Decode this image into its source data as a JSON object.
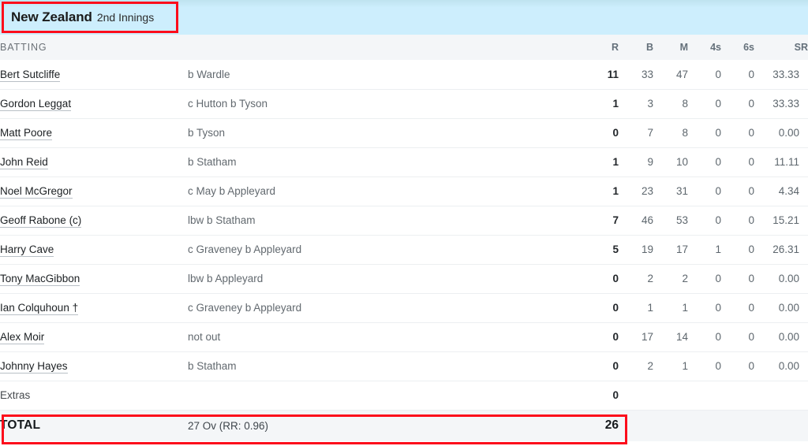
{
  "innings": {
    "team": "New Zealand",
    "label": "2nd Innings"
  },
  "table": {
    "headers": {
      "batting": "BATTING",
      "r": "R",
      "b": "B",
      "m": "M",
      "fours": "4s",
      "sixes": "6s",
      "sr": "SR"
    },
    "rows": [
      {
        "player": "Bert Sutcliffe",
        "dismissal": "b Wardle",
        "r": "11",
        "b": "33",
        "m": "47",
        "fours": "0",
        "sixes": "0",
        "sr": "33.33"
      },
      {
        "player": "Gordon Leggat",
        "dismissal": "c Hutton b Tyson",
        "r": "1",
        "b": "3",
        "m": "8",
        "fours": "0",
        "sixes": "0",
        "sr": "33.33"
      },
      {
        "player": "Matt Poore",
        "dismissal": "b Tyson",
        "r": "0",
        "b": "7",
        "m": "8",
        "fours": "0",
        "sixes": "0",
        "sr": "0.00"
      },
      {
        "player": "John Reid",
        "dismissal": "b Statham",
        "r": "1",
        "b": "9",
        "m": "10",
        "fours": "0",
        "sixes": "0",
        "sr": "11.11"
      },
      {
        "player": "Noel McGregor",
        "dismissal": "c May b Appleyard",
        "r": "1",
        "b": "23",
        "m": "31",
        "fours": "0",
        "sixes": "0",
        "sr": "4.34"
      },
      {
        "player": "Geoff Rabone (c)",
        "dismissal": "lbw b Statham",
        "r": "7",
        "b": "46",
        "m": "53",
        "fours": "0",
        "sixes": "0",
        "sr": "15.21"
      },
      {
        "player": "Harry Cave",
        "dismissal": "c Graveney b Appleyard",
        "r": "5",
        "b": "19",
        "m": "17",
        "fours": "1",
        "sixes": "0",
        "sr": "26.31"
      },
      {
        "player": "Tony MacGibbon",
        "dismissal": "lbw b Appleyard",
        "r": "0",
        "b": "2",
        "m": "2",
        "fours": "0",
        "sixes": "0",
        "sr": "0.00"
      },
      {
        "player": "Ian Colquhoun †",
        "dismissal": "c Graveney b Appleyard",
        "r": "0",
        "b": "1",
        "m": "1",
        "fours": "0",
        "sixes": "0",
        "sr": "0.00"
      },
      {
        "player": "Alex Moir",
        "dismissal": "not out",
        "r": "0",
        "b": "17",
        "m": "14",
        "fours": "0",
        "sixes": "0",
        "sr": "0.00"
      },
      {
        "player": "Johnny Hayes",
        "dismissal": "b Statham",
        "r": "0",
        "b": "2",
        "m": "1",
        "fours": "0",
        "sixes": "0",
        "sr": "0.00"
      }
    ],
    "extras": {
      "label": "Extras",
      "value": "0"
    },
    "total": {
      "label": "TOTAL",
      "detail": "27 Ov (RR: 0.96)",
      "value": "26"
    }
  },
  "colors": {
    "innings_header_bg": "#cdeefd",
    "section_header_bg": "#f4f6f8",
    "annotation_red": "#fc0d1b",
    "row_divider": "#eceff1"
  }
}
